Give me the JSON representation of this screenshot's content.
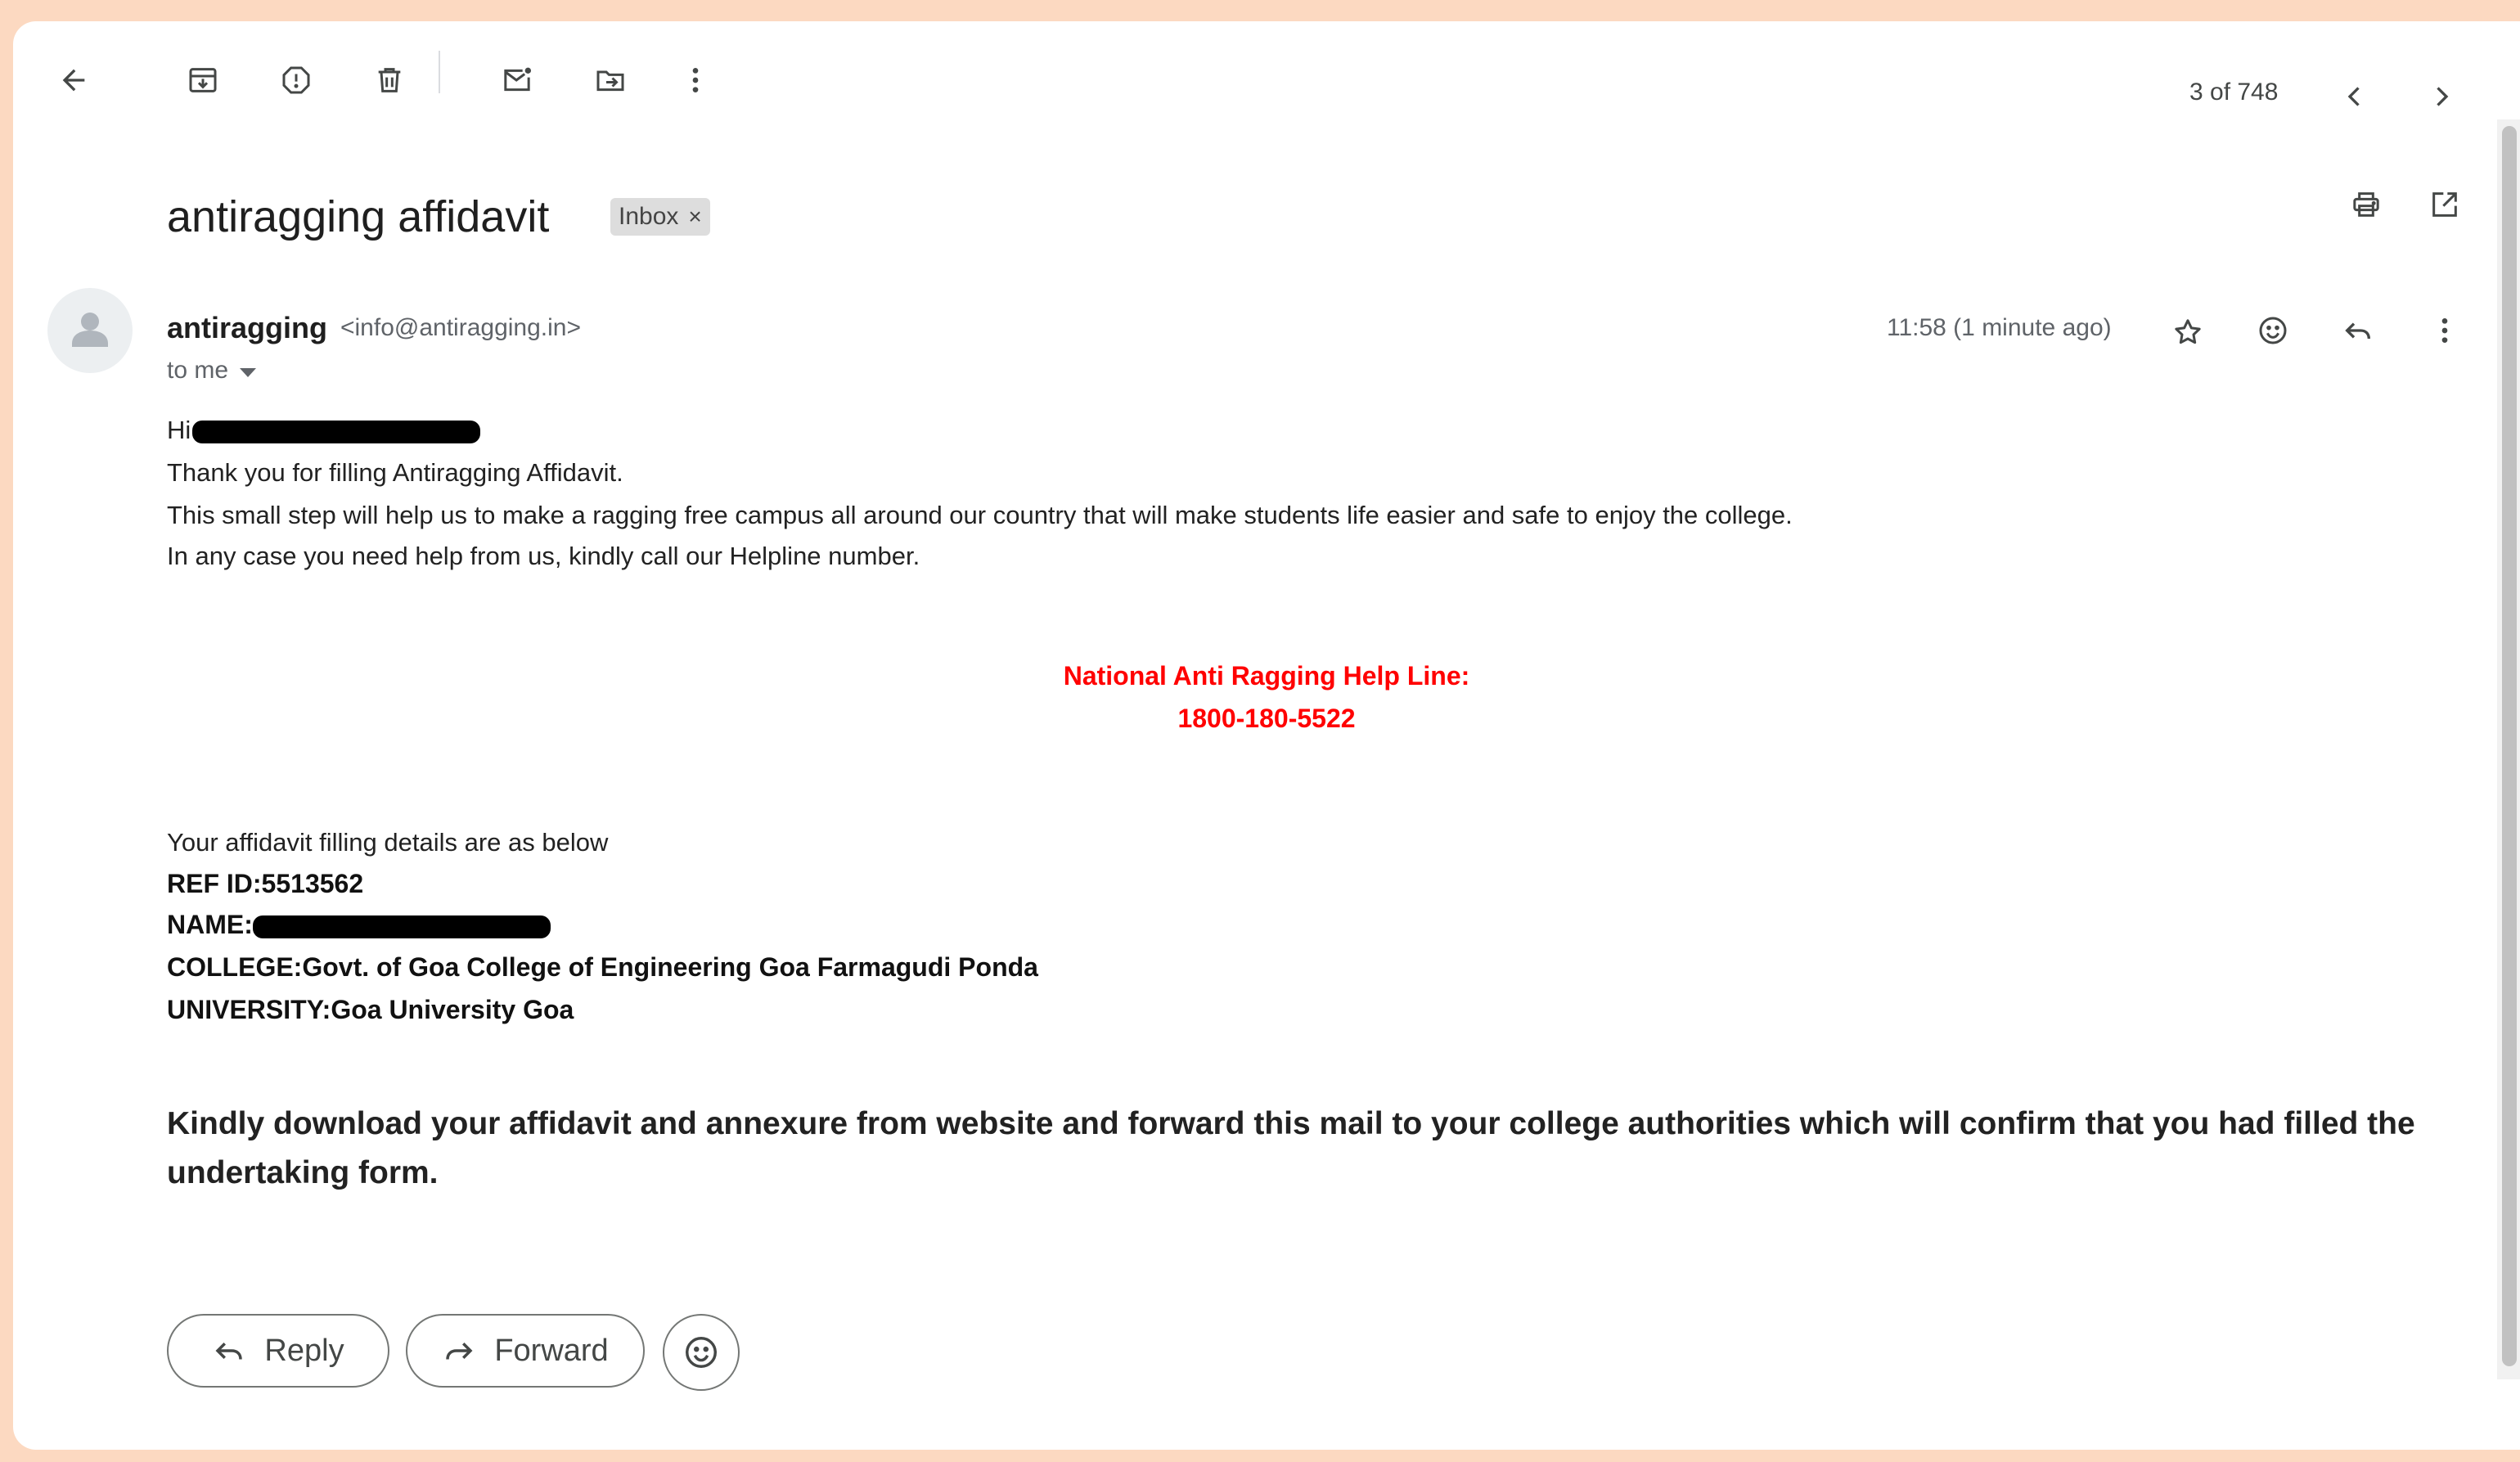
{
  "toolbar": {
    "back": "back-arrow-icon",
    "archive": "archive-icon",
    "report_spam": "report-spam-icon",
    "delete": "trash-icon",
    "mark_unread": "mark-unread-icon",
    "move_to": "move-to-icon",
    "more": "more-vertical-icon",
    "pager_count": "3 of 748",
    "newer": "chevron-left-icon",
    "older": "chevron-right-icon"
  },
  "subject": {
    "title": "antiragging affidavit",
    "label": "Inbox",
    "label_remove": "×",
    "print": "print-icon",
    "new_window": "open-in-new-icon"
  },
  "message": {
    "sender_name": "antiragging",
    "sender_email": "<info@antiragging.in>",
    "recipient": "to me",
    "timestamp": "11:58 (1 minute ago)",
    "star": "star-icon",
    "emoji": "emoji-icon",
    "reply": "reply-icon",
    "more": "more-vertical-icon"
  },
  "body": {
    "greeting": "Hi",
    "line1": "Thank you for filling Antiragging Affidavit.",
    "line2": "This small step will help us to make a ragging free campus all around our country that will make students life easier and safe to enjoy the college.",
    "line3": "In any case you need help from us, kindly call our Helpline number.",
    "helpline_title": "National Anti Ragging Help Line:",
    "helpline_number": "1800-180-5522",
    "details_intro": "Your affidavit filling details are as below",
    "ref_id": "REF ID:5513562",
    "name_label": "NAME:",
    "college": "COLLEGE:Govt. of Goa College of Engineering Goa Farmagudi Ponda",
    "university": "UNIVERSITY:Goa University Goa",
    "instruction": "Kindly download your affidavit and annexure from website and forward this mail to your college authorities which will confirm that you had filled the undertaking form."
  },
  "actions": {
    "reply_label": "Reply",
    "forward_label": "Forward",
    "emoji": "emoji-icon"
  },
  "colors": {
    "helpline": "#ff0000",
    "frame_background": "#fcd9c1"
  }
}
